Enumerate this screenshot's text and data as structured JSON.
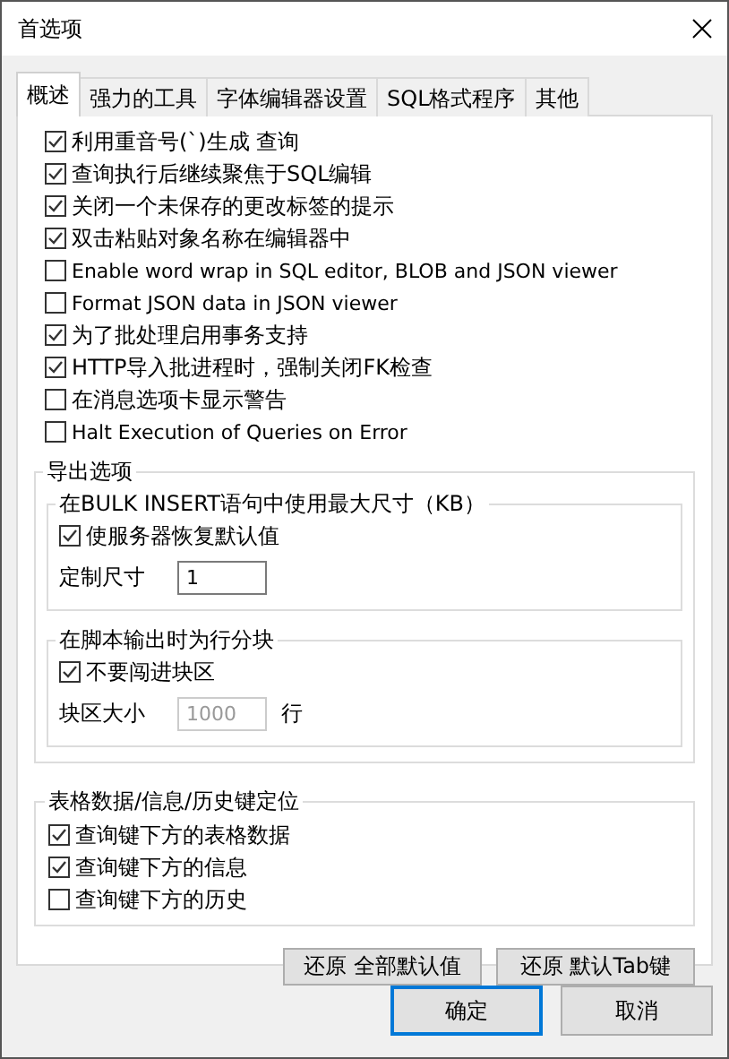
{
  "window": {
    "title": "首选项"
  },
  "tabs": [
    {
      "label": "概述",
      "selected": true
    },
    {
      "label": "强力的工具",
      "selected": false
    },
    {
      "label": "字体编辑器设置",
      "selected": false
    },
    {
      "label": "SQL格式程序",
      "selected": false
    },
    {
      "label": "其他",
      "selected": false
    }
  ],
  "options": [
    {
      "label": "利用重音号(`)生成 查询",
      "checked": true
    },
    {
      "label": "查询执行后继续聚焦于SQL编辑",
      "checked": true
    },
    {
      "label": "关闭一个未保存的更改标签的提示",
      "checked": true
    },
    {
      "label": "双击粘贴对象名称在编辑器中",
      "checked": true
    },
    {
      "label": "Enable word wrap in SQL editor, BLOB and JSON viewer",
      "checked": false
    },
    {
      "label": "Format JSON data in JSON viewer",
      "checked": false
    },
    {
      "label": "为了批处理启用事务支持",
      "checked": true
    },
    {
      "label": "HTTP导入批进程时，强制关闭FK检查",
      "checked": true
    },
    {
      "label": "在消息选项卡显示警告",
      "checked": false
    },
    {
      "label": "Halt Execution of Queries on Error",
      "checked": false
    }
  ],
  "export_options": {
    "title": "导出选项",
    "bulk_insert": {
      "title": "在BULK INSERT语句中使用最大尺寸（KB）",
      "use_server_default": {
        "label": "使服务器恢复默认值",
        "checked": true
      },
      "custom_size": {
        "label": "定制尺寸",
        "value": "1",
        "disabled": false
      }
    },
    "script_chunks": {
      "title": "在脚本输出时为行分块",
      "no_chunk": {
        "label": "不要闯进块区",
        "checked": true
      },
      "chunk_size": {
        "label": "块区大小",
        "value": "1000",
        "disabled": true
      },
      "unit": "行"
    }
  },
  "grid_focus": {
    "title": "表格数据/信息/历史键定位",
    "options": [
      {
        "label": "查询键下方的表格数据",
        "checked": true
      },
      {
        "label": "查询键下方的信息",
        "checked": true
      },
      {
        "label": "查询键下方的历史",
        "checked": false
      }
    ]
  },
  "restore_buttons": [
    "还原 全部默认值",
    "还原 默认Tab键"
  ],
  "dialog_buttons": [
    {
      "label": "确定",
      "default": true
    },
    {
      "label": "取消",
      "default": false
    }
  ]
}
